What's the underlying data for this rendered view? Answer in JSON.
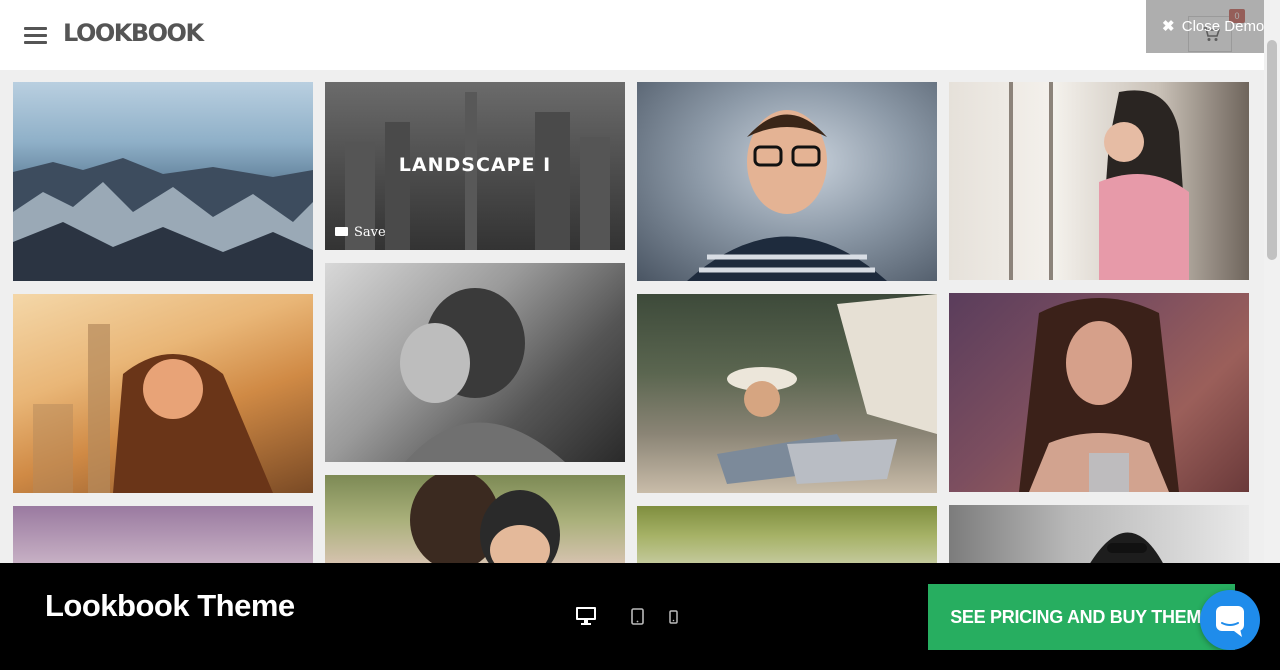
{
  "header": {
    "logo": "LOOKBOOK",
    "menu_icon": "hamburger-menu-icon",
    "cart_icon": "shopping-cart-icon",
    "cart_count": "0"
  },
  "overlay": {
    "close_demo_icon": "close-icon",
    "close_demo_label": "Close Demo"
  },
  "gallery": {
    "featured_title": "LANDSCAPE I",
    "save_icon": "folder-open-icon",
    "save_label": "Save"
  },
  "demo_bar": {
    "title": "Lookbook Theme",
    "device_icons": [
      "desktop-icon",
      "tablet-icon",
      "mobile-icon"
    ],
    "buy_label": "SEE PRICING AND BUY THEME",
    "chat_icon": "chat-bubble-icon",
    "accent": "#27ae60",
    "chat_color": "#1f8ceb"
  }
}
